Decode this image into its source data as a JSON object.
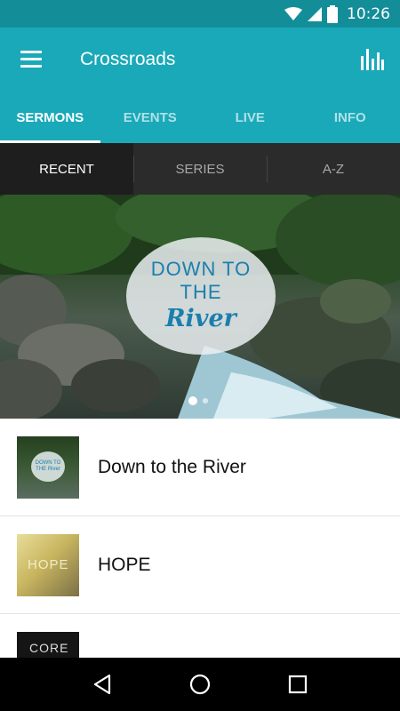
{
  "status_bar": {
    "time": "10:26",
    "icons": [
      "wifi-icon",
      "cell-signal-icon",
      "battery-icon"
    ]
  },
  "app_bar": {
    "title": "Crossroads",
    "menu_icon": "menu-icon",
    "action_icon": "bar-chart-icon"
  },
  "tabs": [
    {
      "label": "SERMONS",
      "active": true
    },
    {
      "label": "EVENTS",
      "active": false
    },
    {
      "label": "LIVE",
      "active": false
    },
    {
      "label": "INFO",
      "active": false
    }
  ],
  "subtabs": [
    {
      "label": "RECENT",
      "active": true
    },
    {
      "label": "SERIES",
      "active": false
    },
    {
      "label": "A-Z",
      "active": false
    }
  ],
  "banner": {
    "line1": "DOWN TO",
    "line2": "THE",
    "line3": "River",
    "page_indicator": {
      "current": 1,
      "total": 2
    }
  },
  "sermons": [
    {
      "title": "Down to the River",
      "thumb_text": "DOWN TO THE River"
    },
    {
      "title": "HOPE",
      "thumb_text": "HOPE"
    },
    {
      "title": "",
      "thumb_text": "CORE"
    }
  ],
  "nav_bar": {
    "icons": [
      "back-icon",
      "home-icon",
      "recents-icon"
    ]
  },
  "colors": {
    "accent": "#1aa9b9",
    "status": "#138e99",
    "subtab_bg": "#2b2b2b"
  }
}
